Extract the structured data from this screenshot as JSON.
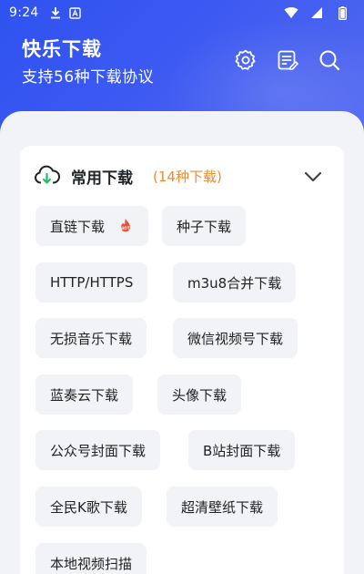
{
  "status_bar": {
    "time": "9:24"
  },
  "header": {
    "title": "快乐下载",
    "subtitle": "支持56种下载协议"
  },
  "section": {
    "title": "常用下载",
    "count": "(14种下载)"
  },
  "chips": [
    {
      "label": "直链下载",
      "hot": true
    },
    {
      "label": "种子下载"
    },
    {
      "label": "HTTP/HTTPS"
    },
    {
      "label": "m3u8合并下载"
    },
    {
      "label": "无损音乐下载"
    },
    {
      "label": "微信视频号下载"
    },
    {
      "label": "蓝奏云下载"
    },
    {
      "label": "头像下载"
    },
    {
      "label": "公众号封面下载"
    },
    {
      "label": "B站封面下载"
    },
    {
      "label": "全民K歌下载"
    },
    {
      "label": "超清壁纸下载"
    },
    {
      "label": "本地视频扫描"
    }
  ],
  "colors": {
    "primary": "#3b57f1",
    "count_orange": "#f08a2c",
    "hot_red": "#f0503a",
    "chip_bg": "#f1f3f6",
    "section_icon_green": "#2fb86a"
  }
}
